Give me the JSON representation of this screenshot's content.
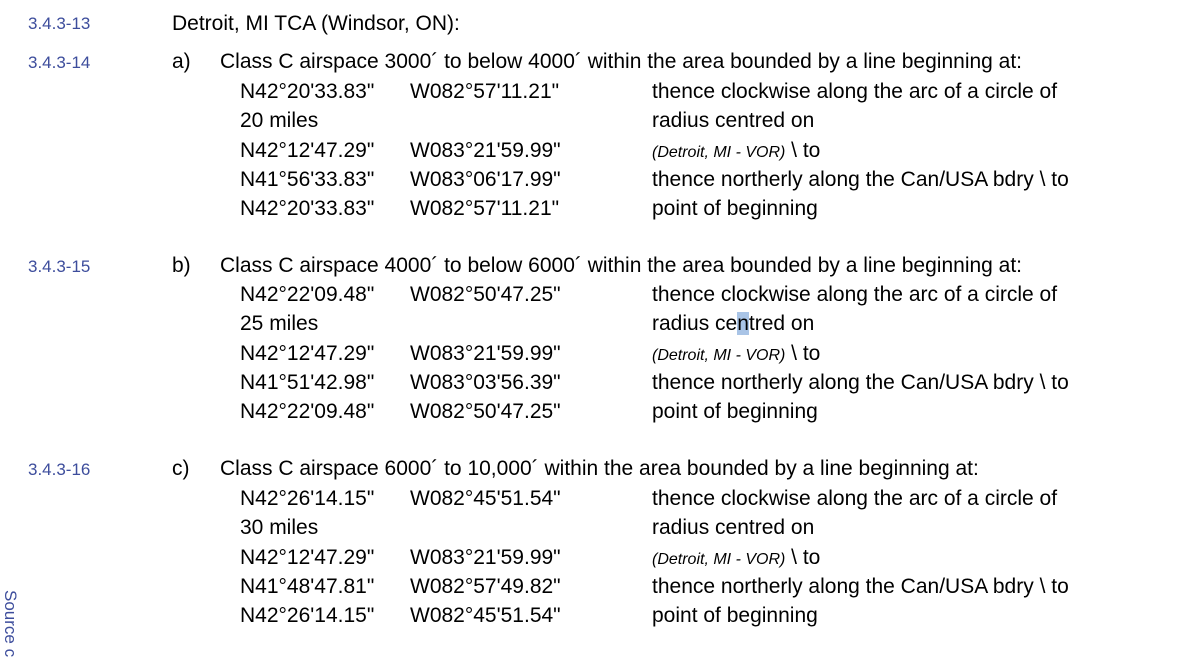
{
  "heading": {
    "section": "3.4.3-13",
    "text": "Detroit, MI TCA (Windsor, ON):"
  },
  "blocks": [
    {
      "section": "3.4.3-14",
      "marker": "a)",
      "title": "Class C airspace 3000´ to below 4000´ within the area bounded by a line beginning at:",
      "rows": [
        {
          "lat": "N42°20'33.83\"",
          "lon": "W082°57'11.21\"",
          "desc": "thence clockwise along the arc of a circle of"
        },
        {
          "lat": "20 miles",
          "lon": "",
          "desc": "radius centred on"
        },
        {
          "lat": "N42°12'47.29\"",
          "lon": "W083°21'59.99\"",
          "vor": "(Detroit, MI - VOR)",
          "desc": " \\ to"
        },
        {
          "lat": "N41°56'33.83\"",
          "lon": "W083°06'17.99\"",
          "desc": "thence northerly along the Can/USA bdry \\ to"
        },
        {
          "lat": "N42°20'33.83\"",
          "lon": "W082°57'11.21\"",
          "desc": "point of beginning"
        }
      ]
    },
    {
      "section": "3.4.3-15",
      "marker": "b)",
      "title": "Class C airspace 4000´ to below 6000´ within the area bounded by a line beginning at:",
      "rows": [
        {
          "lat": "N42°22'09.48\"",
          "lon": "W082°50'47.25\"",
          "desc": "thence clockwise along the arc of a circle of"
        },
        {
          "lat": "25 miles",
          "lon": "",
          "desc_pre": "radius ce",
          "desc_sel": "n",
          "desc_post": "tred on"
        },
        {
          "lat": "N42°12'47.29\"",
          "lon": "W083°21'59.99\"",
          "vor": "(Detroit, MI - VOR)",
          "desc": " \\ to"
        },
        {
          "lat": "N41°51'42.98\"",
          "lon": "W083°03'56.39\"",
          "desc": "thence northerly along the Can/USA bdry \\ to"
        },
        {
          "lat": "N42°22'09.48\"",
          "lon": "W082°50'47.25\"",
          "desc": "point of beginning"
        }
      ]
    },
    {
      "section": "3.4.3-16",
      "marker": "c)",
      "title": "Class C airspace 6000´ to 10,000´ within the area bounded by a line beginning at:",
      "rows": [
        {
          "lat": "N42°26'14.15\"",
          "lon": "W082°45'51.54\"",
          "desc": "thence clockwise along the arc of a circle of"
        },
        {
          "lat": "30 miles",
          "lon": "",
          "desc": "radius centred on"
        },
        {
          "lat": "N42°12'47.29\"",
          "lon": "W083°21'59.99\"",
          "vor": "(Detroit, MI - VOR)",
          "desc": " \\ to"
        },
        {
          "lat": "N41°48'47.81\"",
          "lon": "W082°57'49.82\"",
          "desc": "thence northerly along the Can/USA bdry \\ to"
        },
        {
          "lat": "N42°26'14.15\"",
          "lon": "W082°45'51.54\"",
          "desc": "point of beginning"
        }
      ]
    }
  ],
  "side_note": "Source c",
  "colors": {
    "section_number": "#3d4d9c",
    "text": "#000000",
    "selection": "#a9c4e6"
  }
}
